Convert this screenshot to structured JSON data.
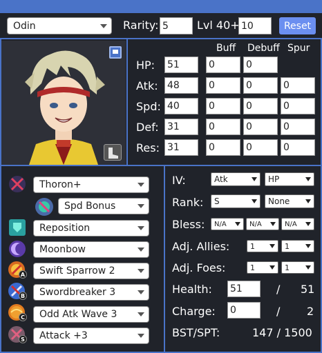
{
  "header": {
    "hero": "Odin",
    "rarity_label": "Rarity:",
    "rarity_value": "5",
    "level_label": "Lvl 40+",
    "merge_value": "10",
    "reset_label": "Reset"
  },
  "stats": {
    "columns": [
      "Buff",
      "Debuff",
      "Spur"
    ],
    "rows": [
      {
        "label": "HP:",
        "base": "51",
        "buff": "0",
        "debuff": "0"
      },
      {
        "label": "Atk:",
        "base": "48",
        "buff": "0",
        "debuff": "0",
        "spur": "0"
      },
      {
        "label": "Spd:",
        "base": "40",
        "buff": "0",
        "debuff": "0",
        "spur": "0"
      },
      {
        "label": "Def:",
        "base": "31",
        "buff": "0",
        "debuff": "0",
        "spur": "0"
      },
      {
        "label": "Res:",
        "base": "31",
        "buff": "0",
        "debuff": "0",
        "spur": "0"
      }
    ]
  },
  "skills": {
    "weapon": "Thoron+",
    "refine": "Spd Bonus",
    "assist": "Reposition",
    "special": "Moonbow",
    "a": "Swift Sparrow 2",
    "b": "Swordbreaker 3",
    "c": "Odd Atk Wave 3",
    "s": "Attack +3",
    "badges": {
      "a": "A",
      "b": "B",
      "c": "C",
      "s": "S"
    }
  },
  "right": {
    "iv_label": "IV:",
    "iv_boon": "Atk",
    "iv_bane": "HP",
    "rank_label": "Rank:",
    "rank_value": "S",
    "rank_support": "None",
    "bless_label": "Bless:",
    "bless": [
      "N/A",
      "N/A",
      "N/A"
    ],
    "allies_label": "Adj. Allies:",
    "allies": [
      "1",
      "1"
    ],
    "foes_label": "Adj. Foes:",
    "foes": [
      "1",
      "1"
    ],
    "health_label": "Health:",
    "health_value": "51",
    "health_sep": "/",
    "health_max": "51",
    "charge_label": "Charge:",
    "charge_value": "0",
    "charge_sep": "/",
    "charge_max": "2",
    "bst_label": "BST/SPT:",
    "bst_value": "147 / 1500"
  },
  "colors": {
    "accent": "#4a73c8",
    "background": "#20232a",
    "button": "#6b8ff0"
  },
  "icons": [
    "sword-icon",
    "refine-icon",
    "assist-icon",
    "special-icon",
    "skill-a-icon",
    "skill-b-icon",
    "skill-c-icon",
    "seal-icon",
    "blue-flag-icon",
    "boot-icon"
  ]
}
